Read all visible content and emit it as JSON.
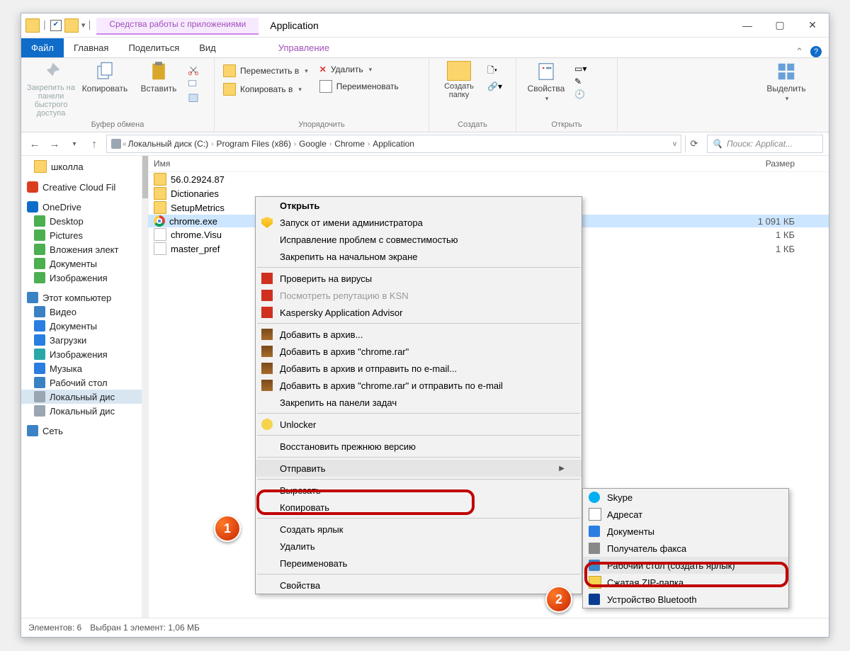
{
  "window": {
    "app_tools_context": "Средства работы с приложениями",
    "title": "Application"
  },
  "tabs": {
    "file": "Файл",
    "home": "Главная",
    "share": "Поделиться",
    "view": "Вид",
    "manage": "Управление"
  },
  "ribbon": {
    "clipboard": {
      "pin": "Закрепить на панели быстрого доступа",
      "copy": "Копировать",
      "paste": "Вставить",
      "group": "Буфер обмена"
    },
    "organize": {
      "move_to": "Переместить в",
      "copy_to": "Копировать в",
      "delete": "Удалить",
      "rename": "Переименовать",
      "group": "Упорядочить"
    },
    "new": {
      "new_folder": "Создать папку",
      "group": "Создать"
    },
    "open": {
      "properties": "Свойства",
      "group": "Открыть"
    },
    "select": {
      "select": "Выделить"
    }
  },
  "breadcrumbs": [
    "Локальный диск (C:)",
    "Program Files (x86)",
    "Google",
    "Chrome",
    "Application"
  ],
  "search": {
    "placeholder": "Поиск: Applicat..."
  },
  "columns": {
    "name": "Имя",
    "size": "Размер"
  },
  "tree": {
    "quick": [
      {
        "label": "школла",
        "icon": "folder"
      },
      {
        "label": "Creative Cloud Fil",
        "icon": "cc"
      }
    ],
    "onedrive": {
      "label": "OneDrive",
      "items": [
        {
          "label": "Desktop",
          "icon": "chk"
        },
        {
          "label": "Pictures",
          "icon": "chk"
        },
        {
          "label": "Вложения элект",
          "icon": "chk"
        },
        {
          "label": "Документы",
          "icon": "chk"
        },
        {
          "label": "Изображения",
          "icon": "chk"
        }
      ]
    },
    "thispc": {
      "label": "Этот компьютер",
      "items": [
        {
          "label": "Видео",
          "icon": "mon"
        },
        {
          "label": "Документы",
          "icon": "doc"
        },
        {
          "label": "Загрузки",
          "icon": "dl"
        },
        {
          "label": "Изображения",
          "icon": "pic"
        },
        {
          "label": "Музыка",
          "icon": "music"
        },
        {
          "label": "Рабочий стол",
          "icon": "mon"
        },
        {
          "label": "Локальный дис",
          "icon": "hd",
          "selected": true
        },
        {
          "label": "Локальный дис",
          "icon": "hd"
        }
      ]
    },
    "network": {
      "label": "Сеть"
    }
  },
  "files": [
    {
      "name": "56.0.2924.87",
      "icon": "folder",
      "size": ""
    },
    {
      "name": "Dictionaries",
      "icon": "folder",
      "size": ""
    },
    {
      "name": "SetupMetrics",
      "icon": "folder",
      "size": ""
    },
    {
      "name": "chrome.exe",
      "icon": "chrome",
      "size": "1 091 КБ",
      "selected": true
    },
    {
      "name": "chrome.Visu",
      "icon": "file",
      "size": "1 КБ"
    },
    {
      "name": "master_pref",
      "icon": "file",
      "size": "1 КБ"
    }
  ],
  "status": {
    "elements": "Элементов: 6",
    "selection": "Выбран 1 элемент: 1,06 МБ"
  },
  "context_menu": {
    "items": [
      {
        "label": "Открыть",
        "bold": true
      },
      {
        "label": "Запуск от имени администратора",
        "icon": "shield"
      },
      {
        "label": "Исправление проблем с совместимостью"
      },
      {
        "label": "Закрепить на начальном экране"
      },
      {
        "sep": true
      },
      {
        "label": "Проверить на вирусы",
        "icon": "kasp"
      },
      {
        "label": "Посмотреть репутацию в KSN",
        "icon": "kasp",
        "dim": true
      },
      {
        "label": "Kaspersky Application Advisor",
        "icon": "kasp"
      },
      {
        "sep": true
      },
      {
        "label": "Добавить в архив...",
        "icon": "rar"
      },
      {
        "label": "Добавить в архив \"chrome.rar\"",
        "icon": "rar"
      },
      {
        "label": "Добавить в архив и отправить по e-mail...",
        "icon": "rar"
      },
      {
        "label": "Добавить в архив \"chrome.rar\" и отправить по e-mail",
        "icon": "rar"
      },
      {
        "label": "Закрепить на панели задач"
      },
      {
        "sep": true
      },
      {
        "label": "Unlocker",
        "icon": "unl"
      },
      {
        "sep": true
      },
      {
        "label": "Восстановить прежнюю версию"
      },
      {
        "sep": true
      },
      {
        "label": "Отправить",
        "submenu": true,
        "highlight": true
      },
      {
        "sep": true
      },
      {
        "label": "Вырезать"
      },
      {
        "label": "Копировать"
      },
      {
        "sep": true
      },
      {
        "label": "Создать ярлык"
      },
      {
        "label": "Удалить"
      },
      {
        "label": "Переименовать"
      },
      {
        "sep": true
      },
      {
        "label": "Свойства"
      }
    ]
  },
  "sendto_menu": {
    "items": [
      {
        "label": "Skype",
        "icon": "skype"
      },
      {
        "label": "Адресат",
        "icon": "mail"
      },
      {
        "label": "Документы",
        "icon": "doc"
      },
      {
        "label": "Получатель факса",
        "icon": "fax"
      },
      {
        "label": "Рабочий стол (создать ярлык)",
        "icon": "mon",
        "highlight": true
      },
      {
        "label": "Сжатая ZIP-папка",
        "icon": "zip"
      },
      {
        "label": "Устройство Bluetooth",
        "icon": "bt"
      }
    ]
  },
  "badges": {
    "one": "1",
    "two": "2"
  }
}
